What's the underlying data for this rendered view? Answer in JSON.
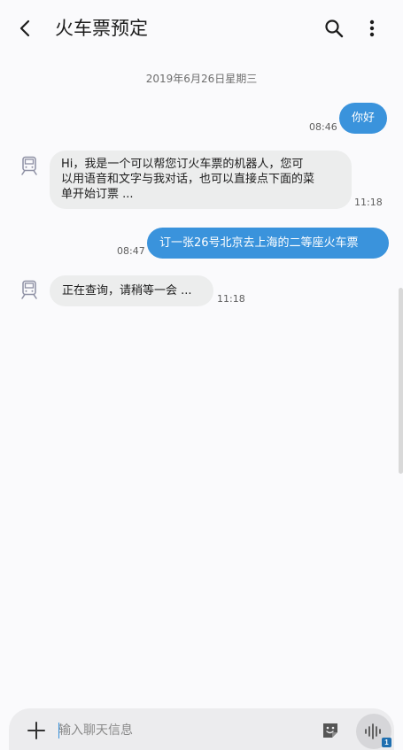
{
  "header": {
    "title": "火车票预定",
    "back_icon": "chevron-left-icon",
    "search_icon": "search-icon",
    "more_icon": "more-vertical-icon"
  },
  "conversation": {
    "date_separator": "2019年6月26日星期三",
    "messages": [
      {
        "direction": "outgoing",
        "text": "你好",
        "time": "08:46"
      },
      {
        "direction": "incoming",
        "line1": "Hi，我是一个可以帮您订火车票的机器人，您可",
        "line2": "以用语音和文字与我对话，也可以直接点下面的菜",
        "line3": "单开始订票 ...",
        "time": "11:18",
        "avatar_icon": "train-icon"
      },
      {
        "direction": "outgoing",
        "text": "订一张26号北京去上海的二等座火车票",
        "time": "08:47"
      },
      {
        "direction": "incoming",
        "text": "正在查询，请稍等一会 ...",
        "time": "11:18",
        "avatar_icon": "train-icon"
      }
    ]
  },
  "composer": {
    "placeholder": "输入聊天信息",
    "plus_icon": "plus-icon",
    "sticker_icon": "sticker-icon",
    "voice_icon": "voice-wave-icon",
    "sim_badge": "1"
  },
  "colors": {
    "outgoing_bubble": "#3a93dc",
    "incoming_bubble": "#eceded",
    "background": "#fafafc"
  }
}
